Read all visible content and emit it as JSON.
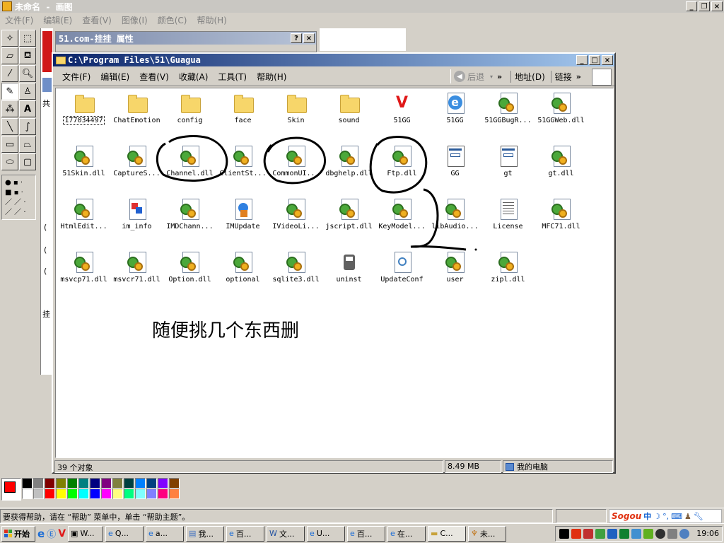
{
  "paint": {
    "title": "未命名 - 画图",
    "menu": [
      "文件(F)",
      "编辑(E)",
      "查看(V)",
      "图像(I)",
      "颜色(C)",
      "帮助(H)"
    ],
    "status_text": "要获得帮助，请在 “帮助” 菜单中，单击 “帮助主题”。",
    "palette_colors": [
      "#000000",
      "#808080",
      "#800000",
      "#808000",
      "#008000",
      "#008080",
      "#000080",
      "#800080",
      "#808040",
      "#004040",
      "#0080ff",
      "#004080",
      "#8000ff",
      "#804000",
      "#ffffff",
      "#c0c0c0",
      "#ff0000",
      "#ffff00",
      "#00ff00",
      "#00ffff",
      "#0000ff",
      "#ff00ff",
      "#ffff80",
      "#00ff80",
      "#80ffff",
      "#8080ff",
      "#ff0080",
      "#ff8040"
    ],
    "left_text_fragments": [
      "共",
      "挂",
      "(",
      "(",
      "(",
      "挂"
    ],
    "annotation_text": "随便挑几个东西删"
  },
  "props_dialog": {
    "title": "51.com-挂挂 属性",
    "help_btn": "?",
    "close_btn": "×"
  },
  "explorer": {
    "title": "C:\\Program Files\\51\\Guagua",
    "menu": [
      "文件(F)",
      "编辑(E)",
      "查看(V)",
      "收藏(A)",
      "工具(T)",
      "帮助(H)"
    ],
    "back_label": "后退",
    "address_label": "地址(D)",
    "links_label": "链接",
    "status_count": "39 个对象",
    "status_size": "8.49 MB",
    "status_location": "我的电脑",
    "files": [
      {
        "name": "177034497",
        "type": "folder"
      },
      {
        "name": "ChatEmotion",
        "type": "folder"
      },
      {
        "name": "config",
        "type": "folder"
      },
      {
        "name": "face",
        "type": "folder"
      },
      {
        "name": "Skin",
        "type": "folder"
      },
      {
        "name": "sound",
        "type": "folder"
      },
      {
        "name": "51GG",
        "type": "app-51"
      },
      {
        "name": "51GG",
        "type": "ie"
      },
      {
        "name": "51GGBugR...",
        "type": "dll"
      },
      {
        "name": "51GGWeb.dll",
        "type": "dll"
      },
      {
        "name": "51Skin.dll",
        "type": "dll"
      },
      {
        "name": "CaptureS...",
        "type": "dll"
      },
      {
        "name": "Channel.dll",
        "type": "dll"
      },
      {
        "name": "ClientSt...",
        "type": "dll"
      },
      {
        "name": "CommonUI...",
        "type": "dll"
      },
      {
        "name": "dbghelp.dll",
        "type": "dll"
      },
      {
        "name": "Ftp.dll",
        "type": "dll"
      },
      {
        "name": "GG",
        "type": "window"
      },
      {
        "name": "gt",
        "type": "window"
      },
      {
        "name": "gt.dll",
        "type": "dll"
      },
      {
        "name": "HtmlEdit...",
        "type": "dll"
      },
      {
        "name": "im_info",
        "type": "img"
      },
      {
        "name": "IMDChann...",
        "type": "dll"
      },
      {
        "name": "IMUpdate",
        "type": "update"
      },
      {
        "name": "IVideoLi...",
        "type": "dll"
      },
      {
        "name": "jscript.dll",
        "type": "dll"
      },
      {
        "name": "KeyModel...",
        "type": "dll"
      },
      {
        "name": "libAudio...",
        "type": "dll"
      },
      {
        "name": "License",
        "type": "txt"
      },
      {
        "name": "MFC71.dll",
        "type": "dll"
      },
      {
        "name": "msvcp71.dll",
        "type": "dll"
      },
      {
        "name": "msvcr71.dll",
        "type": "dll"
      },
      {
        "name": "Option.dll",
        "type": "dll"
      },
      {
        "name": "optional",
        "type": "dll"
      },
      {
        "name": "sqlite3.dll",
        "type": "dll"
      },
      {
        "name": "uninst",
        "type": "uninst"
      },
      {
        "name": "UpdateConf",
        "type": "conf"
      },
      {
        "name": "user",
        "type": "dll"
      },
      {
        "name": "zipl.dll",
        "type": "dll"
      }
    ]
  },
  "taskbar": {
    "start_label": "开始",
    "tasks": [
      "W...",
      "Q...",
      "a...",
      "我...",
      "百...",
      "文...",
      "U...",
      "百...",
      "在...",
      "C...",
      "未..."
    ],
    "clock": "19:06",
    "ime_label": "中"
  }
}
